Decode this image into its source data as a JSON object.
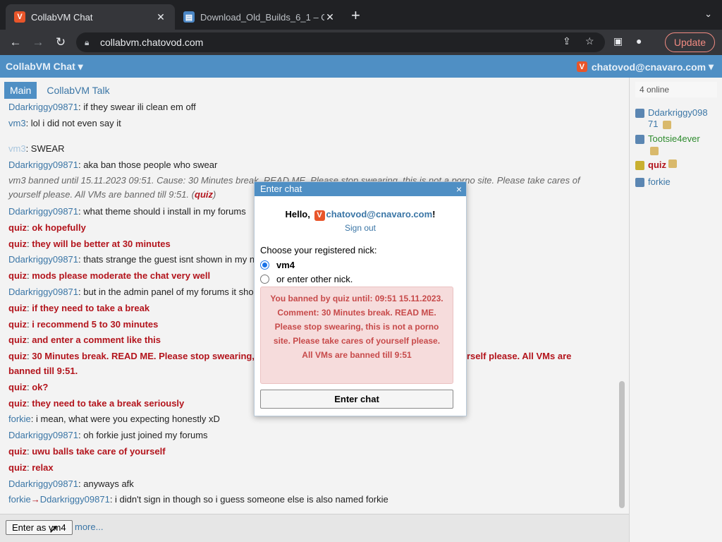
{
  "browser": {
    "tabs": [
      {
        "title": "CollabVM Chat",
        "favicon": "V"
      },
      {
        "title": "Download_Old_Builds_6_1 – O"
      }
    ],
    "url": "collabvm.chatovod.com",
    "update_label": "Update"
  },
  "app": {
    "title": "CollabVM Chat",
    "account": "chatovod@cnavaro.com"
  },
  "chat": {
    "tabs": [
      "Main",
      "CollabVM Talk"
    ],
    "messages": [
      {
        "nick": "Ddarkriggy09871",
        "style": "blue",
        "text": "if they swear ili clean em off"
      },
      {
        "nick": "vm3",
        "style": "blue",
        "text": "lol i did not even say it"
      },
      {
        "nick": "vm3",
        "style": "faded",
        "text": "SWEAR"
      },
      {
        "nick": "Ddarkriggy09871",
        "style": "blue",
        "text": "aka ban those people who swear"
      },
      {
        "system": "vm3 banned until 15.11.2023 09:51. Cause: 30 Minutes break. READ ME. Please stop swearing, this is not a porno site. Please take cares of yourself please. All VMs are banned till 9:51. (",
        "system_by": "quiz",
        "system_end": ")"
      },
      {
        "nick": "Ddarkriggy09871",
        "style": "blue",
        "text": "what theme should i install in my forums"
      },
      {
        "nick": "quiz",
        "style": "red",
        "text": "ok hopefully"
      },
      {
        "nick": "quiz",
        "style": "red",
        "text": "they will be better at 30 minutes"
      },
      {
        "nick": "Ddarkriggy09871",
        "style": "blue",
        "text": "thats strange the guest isnt shown in my n"
      },
      {
        "nick": "quiz",
        "style": "red",
        "text": "mods please moderate the chat very well"
      },
      {
        "nick": "Ddarkriggy09871",
        "style": "blue",
        "text": "but in the admin panel of my forums it sho"
      },
      {
        "nick": "quiz",
        "style": "red",
        "text": "if they need to take a break"
      },
      {
        "nick": "quiz",
        "style": "red",
        "text": "i recommend 5 to 30 minutes"
      },
      {
        "nick": "quiz",
        "style": "red",
        "text": "and enter a comment like this"
      },
      {
        "nick": "quiz",
        "style": "red",
        "text": "30 Minutes break. READ ME. Please stop swearing,",
        "text2": "rself please. All VMs are",
        "text3": "banned till 9:51."
      },
      {
        "nick": "quiz",
        "style": "red",
        "text": "ok?"
      },
      {
        "nick": "quiz",
        "style": "red",
        "text": "they need to take a break seriously"
      },
      {
        "nick": "forkie",
        "style": "blue",
        "text": "i mean, what were you expecting honestly xD"
      },
      {
        "nick": "Ddarkriggy09871",
        "style": "blue",
        "text": "oh forkie just joined my forums"
      },
      {
        "nick": "quiz",
        "style": "red",
        "text": "uwu balls take care of yourself"
      },
      {
        "nick": "quiz",
        "style": "red",
        "text": "relax"
      },
      {
        "nick": "Ddarkriggy09871",
        "style": "blue",
        "text": "anyways afk"
      },
      {
        "nick": "forkie",
        "to": "Ddarkriggy09871",
        "arrow": "→",
        "style": "blue",
        "text": "i didn't sign in though so i guess someone else is also named forkie"
      }
    ],
    "enter_as_label": "Enter as vm4",
    "more_label": "more..."
  },
  "sidebar": {
    "online": "4 online",
    "users": [
      {
        "name": "Ddarkriggy098",
        "name2": "71",
        "color": "#3b76a6"
      },
      {
        "name": "Tootsie4ever",
        "color": "#2e8b2e"
      },
      {
        "name": "quiz",
        "color": "#b3141c"
      },
      {
        "name": "forkie",
        "color": "#3b76a6"
      }
    ]
  },
  "modal": {
    "title": "Enter chat",
    "close": "×",
    "hello_prefix": "Hello,",
    "email": "chatovod@cnavaro.com",
    "hello_suffix": "!",
    "signout": "Sign out",
    "choose": "Choose your registered nick:",
    "option1": "vm4",
    "option2": "or enter other nick.",
    "ban_message": "You banned by quiz until: 09:51 15.11.2023. Comment: 30 Minutes break. READ ME. Please stop swearing, this is not a porno site. Please take cares of yourself please. All VMs are banned till 9:51",
    "enter_button": "Enter chat"
  }
}
